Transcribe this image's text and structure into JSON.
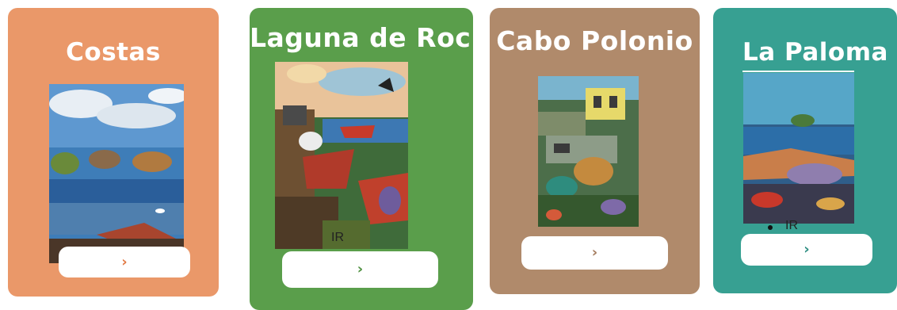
{
  "colors": {
    "costas": "#EA9869",
    "laguna": "#5A9E4B",
    "cabo": "#B08A6B",
    "paloma": "#37A092",
    "chevron_orange": "#E27A45",
    "chevron_green": "#4C8F3E",
    "chevron_brown": "#A47C5E",
    "chevron_teal": "#2E8E82"
  },
  "cards": [
    {
      "title": "Costas",
      "button_icon": "chevron-right-icon",
      "button_text": "›"
    },
    {
      "title": "Laguna de Rocha",
      "button_icon": "chevron-right-icon",
      "button_text": "›",
      "link_text": "IR"
    },
    {
      "title": "Cabo Polonio",
      "button_icon": "chevron-right-icon",
      "button_text": "›"
    },
    {
      "title": "La Paloma",
      "button_icon": "chevron-right-icon",
      "button_text": "›",
      "link_text": "IR"
    }
  ]
}
